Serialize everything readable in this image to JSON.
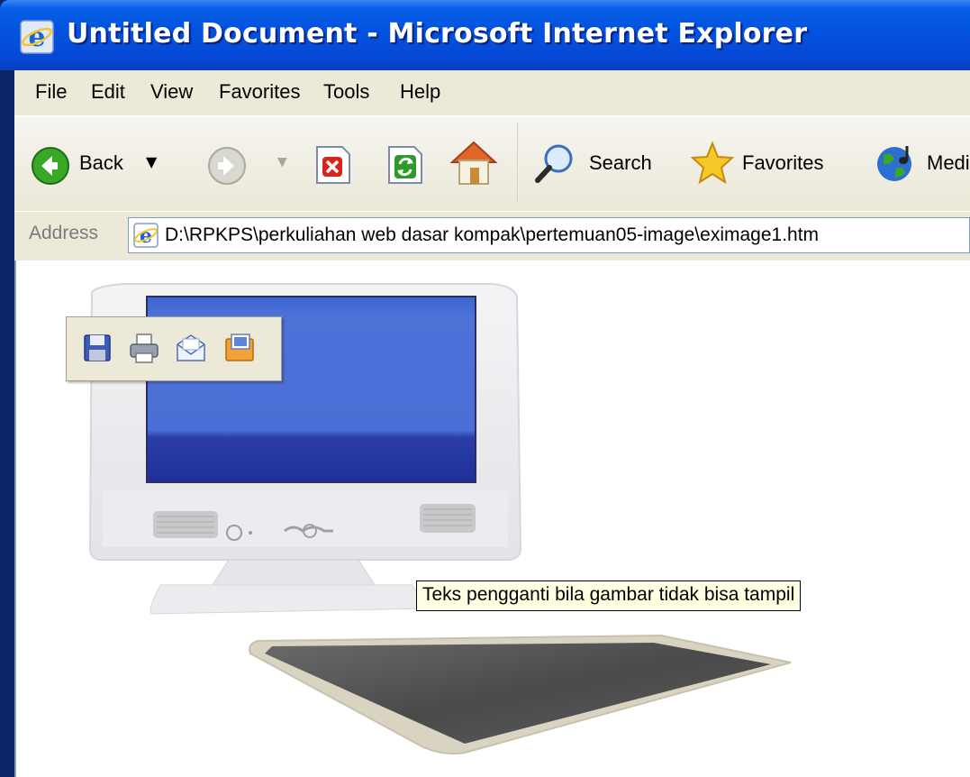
{
  "window": {
    "title": "Untitled Document - Microsoft Internet Explorer"
  },
  "menu": [
    "File",
    "Edit",
    "View",
    "Favorites",
    "Tools",
    "Help"
  ],
  "toolbar": {
    "back_label": "Back",
    "search_label": "Search",
    "favorites_label": "Favorites",
    "media_label": "Media"
  },
  "address": {
    "label": "Address",
    "url": "D:\\RPKPS\\perkuliahan web dasar kompak\\pertemuan05-image\\eximage1.htm"
  },
  "content": {
    "tooltip": "Teks pengganti bila gambar tidak bisa tampil"
  },
  "colors": {
    "titlebar": "#0254e0",
    "chrome": "#ece9d8",
    "tooltip_bg": "#ffffe1",
    "screen_blue": "#4a6fd6"
  },
  "icons": {
    "image_toolbar": [
      "save-icon",
      "print-icon",
      "email-icon",
      "my-pictures-icon"
    ]
  }
}
